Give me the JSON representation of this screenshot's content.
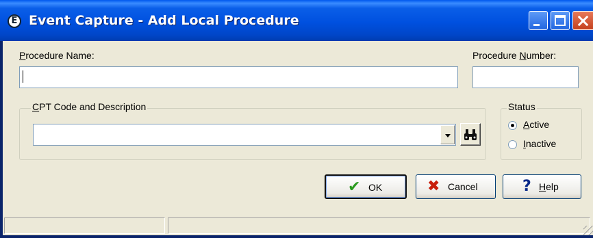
{
  "window": {
    "title": "Event Capture - Add Local Procedure",
    "app_icon_glyph": "E"
  },
  "form": {
    "procedure_name": {
      "label_first": "P",
      "label_rest": "rocedure Name:",
      "value": ""
    },
    "procedure_number": {
      "label_before": "Procedure ",
      "label_key": "N",
      "label_after": "umber:",
      "value": ""
    },
    "cpt": {
      "legend_first": "C",
      "legend_rest": "PT Code and Description",
      "selected": "",
      "search_icon": "binoculars-icon"
    },
    "status": {
      "legend": "Status",
      "options": [
        {
          "key": "A",
          "rest": "ctive",
          "checked": true
        },
        {
          "key": "I",
          "rest": "nactive",
          "checked": false
        }
      ]
    }
  },
  "buttons": {
    "ok": {
      "label": "OK",
      "icon": "checkmark-icon",
      "color": "#2a9a1e"
    },
    "cancel": {
      "label": "Cancel",
      "icon": "x-icon",
      "color": "#c81e0a"
    },
    "help": {
      "label_key": "H",
      "label_rest": "elp",
      "icon": "question-icon",
      "color": "#0a2a8a"
    }
  },
  "statusbar": {
    "panes": [
      "",
      ""
    ]
  }
}
